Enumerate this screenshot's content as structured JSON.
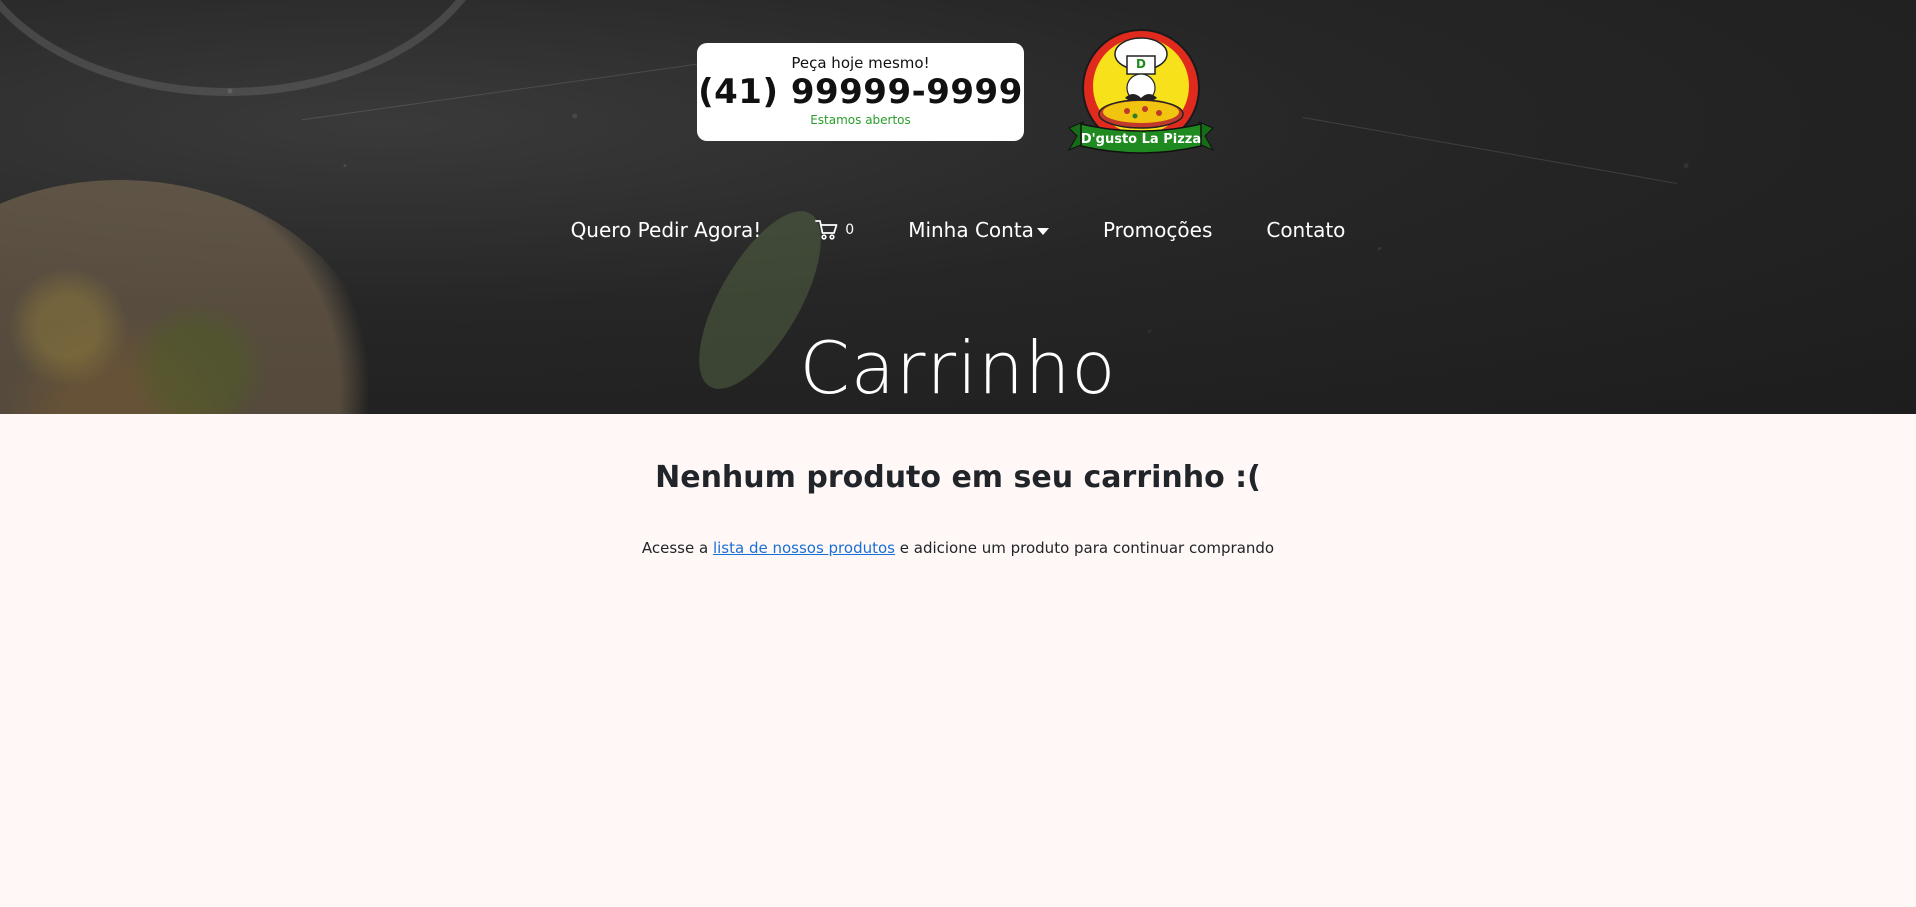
{
  "header": {
    "phone_card": {
      "pre": "Peça hoje mesmo!",
      "phone": "(41) 99999-9999",
      "status": "Estamos abertos"
    },
    "logo": {
      "initial": "D",
      "brand": "D'gusto La Pizza"
    }
  },
  "nav": {
    "order_now": "Quero Pedir Agora!",
    "cart_count": "0",
    "account": "Minha Conta",
    "promotions": "Promoções",
    "contact": "Contato"
  },
  "hero": {
    "title": "Carrinho"
  },
  "cart": {
    "empty_title": "Nenhum produto em seu carrinho :(",
    "msg_before": "Acesse a",
    "msg_link": "lista de nossos produtos",
    "msg_after": "e adicione um produto para continuar comprando"
  },
  "colors": {
    "page_bg": "#fff8f7",
    "hero_bg": "#262626",
    "status_green": "#2a9d2a",
    "link_blue": "#1a6fd6",
    "logo_red": "#e02a1e",
    "logo_yellow": "#f7e11a",
    "logo_green": "#1f8a1f"
  },
  "icons": {
    "cart": "shopping-cart-icon",
    "dropdown": "caret-down-icon"
  }
}
